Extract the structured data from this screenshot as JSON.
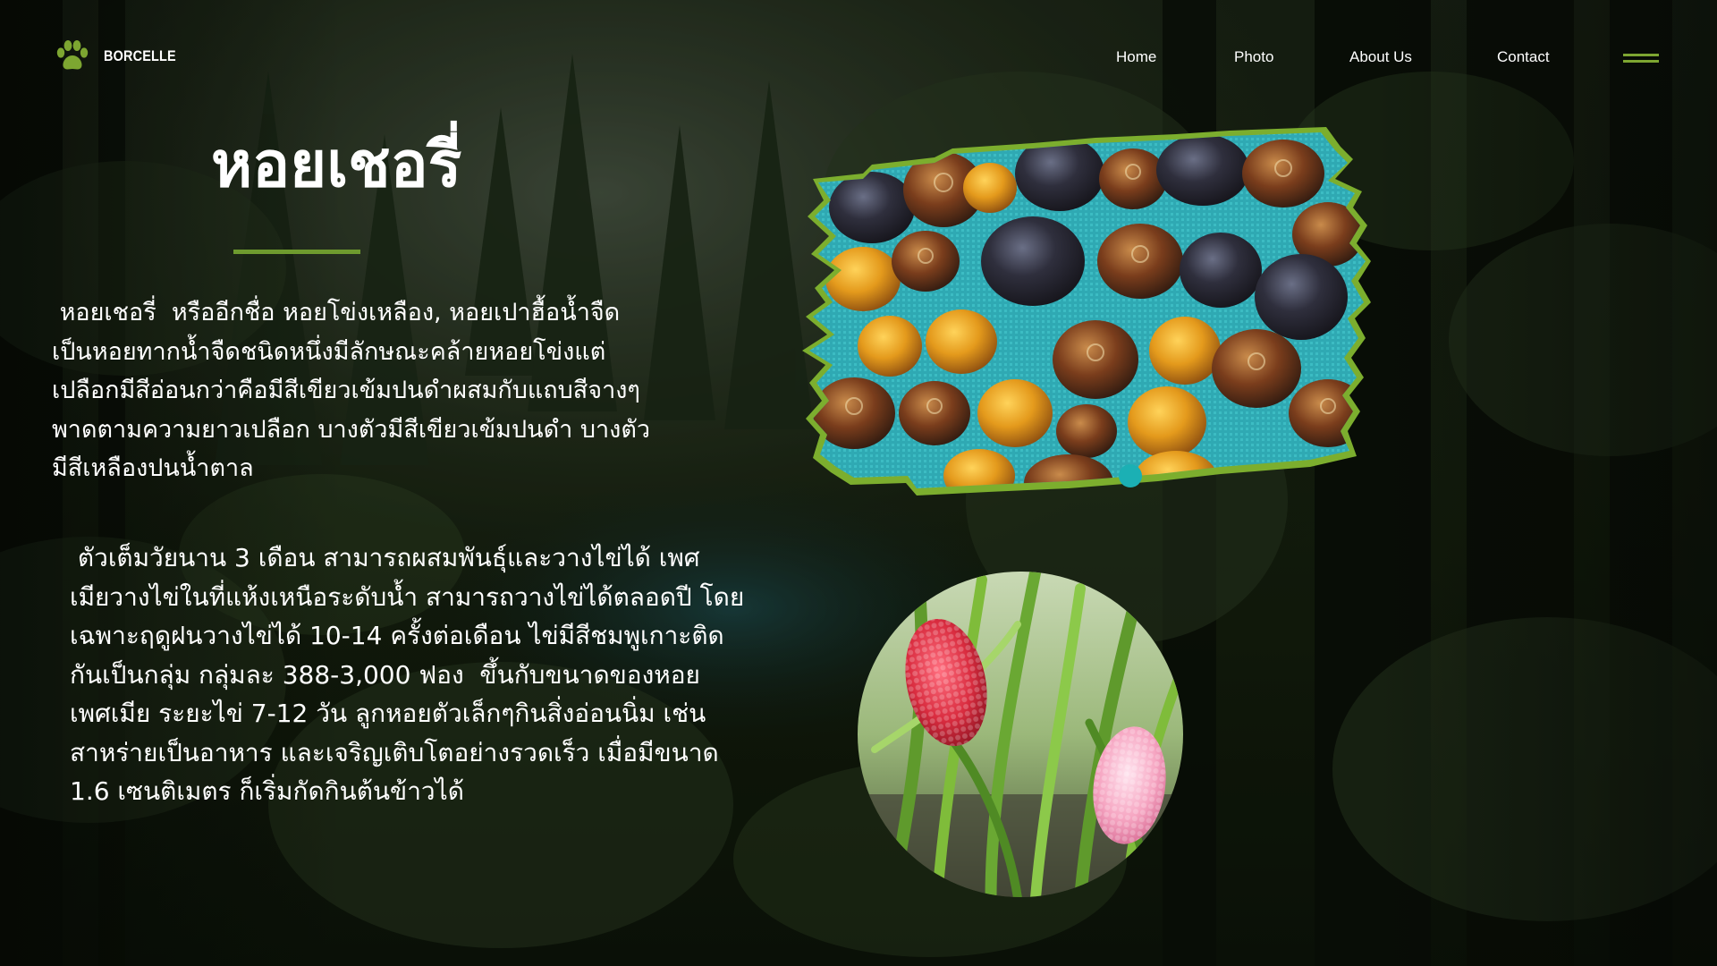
{
  "brand": {
    "name": "BORCELLE",
    "logo_icon": "paw-print-icon",
    "accent_color": "#6e9a2e"
  },
  "nav": {
    "items": [
      {
        "label": "Home"
      },
      {
        "label": "Photo"
      },
      {
        "label": "About Us"
      },
      {
        "label": "Contact"
      }
    ],
    "menu_icon": "hamburger-menu-icon"
  },
  "content": {
    "title": "หอยเชอรี่",
    "paragraphs": [
      " หอยเชอรี่  หรืออีกชื่อ หอยโข่งเหลือง, หอยเปาฮื้อน้ำจืด\nเป็นหอยทากน้ำจืดชนิดหนึ่งมีลักษณะคล้ายหอยโข่งแต่\nเปลือกมีสีอ่อนกว่าคือมีสีเขียวเข้มปนดำผสมกับแถบสีจางๆ\nพาดตามความยาวเปลือก บางตัวมีสีเขียวเข้มปนดำ บางตัว\nมีสีเหลืองปนน้ำตาล",
      " ตัวเต็มวัยนาน 3 เดือน สามารถผสมพันธุ์และวางไข่ได้ เพศ\nเมียวางไข่ในที่แห้งเหนือระดับน้ำ สามารถวางไข่ได้ตลอดปี โดย\nเฉพาะฤดูฝนวางไข่ได้ 10-14 ครั้งต่อเดือน ไข่มีสีชมพูเกาะติด\nกันเป็นกลุ่ม กลุ่มละ 388-3,000 ฟอง  ขึ้นกับขนาดของหอย\nเพศเมีย ระยะไข่ 7-12 วัน ลูกหอยตัวเล็กๆกินสิ่งอ่อนนิ่ม เช่น\nสาหร่ายเป็นอาหาร และเจริญเติบโตอย่างรวดเร็ว เมื่อมีขนาด\n1.6 เซนติเมตร ก็เริ่มกัดกินต้นข้าวได้"
    ]
  },
  "images": {
    "background": "misty-forest-background",
    "main_photo": "apple-snails-on-blue-mesh-photo",
    "secondary_photo": "pink-snail-eggs-on-rice-stalks-photo"
  },
  "carousel": {
    "active_dot_color": "#1bb0b4"
  }
}
